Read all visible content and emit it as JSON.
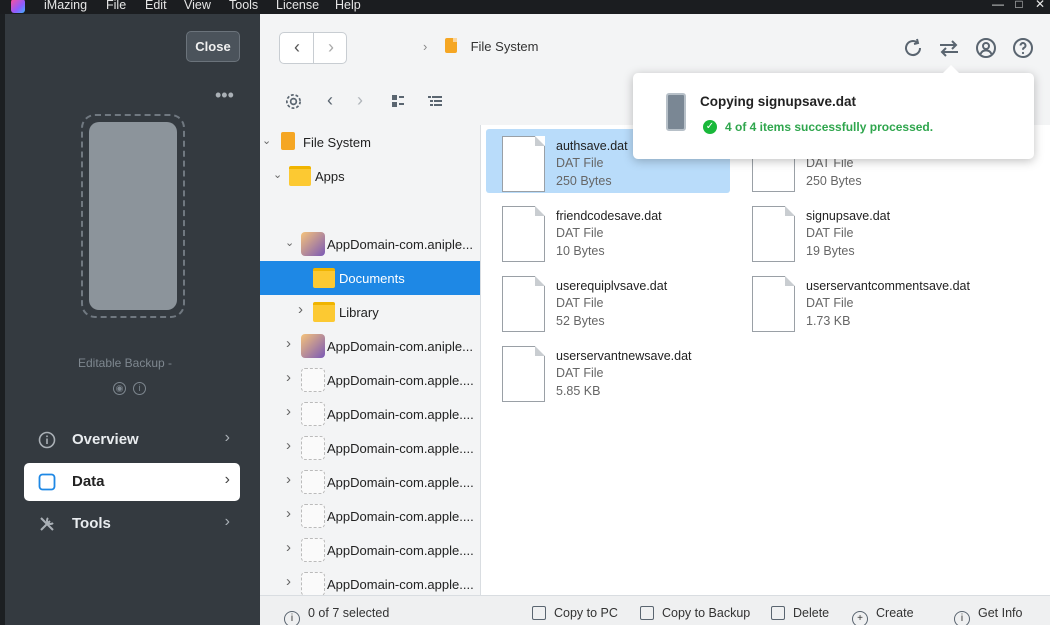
{
  "menubar": {
    "app_name": "iMazing",
    "items": [
      "File",
      "Edit",
      "View",
      "Tools",
      "License",
      "Help"
    ],
    "window_controls": [
      "—",
      "□",
      "✕"
    ]
  },
  "sidebar": {
    "close_label": "Close",
    "more_label": "•••",
    "backup_label": "Editable Backup -",
    "nav": [
      {
        "label": "Overview",
        "icon": "info-icon"
      },
      {
        "label": "Data",
        "icon": "checkbox-icon"
      },
      {
        "label": "Tools",
        "icon": "wrench-icon"
      }
    ]
  },
  "toolbar": {
    "back": "‹",
    "forward": "›",
    "breadcrumb_sep": "›",
    "breadcrumb": "File System",
    "icons": [
      "refresh-icon",
      "transfer-icon",
      "account-icon",
      "help-icon"
    ]
  },
  "tree": {
    "rows": [
      {
        "label": "File System",
        "arrow": "⌄",
        "icon": "filesystem"
      },
      {
        "label": "Apps",
        "arrow": "⌄",
        "icon": "folder"
      },
      {
        "label": "AppDomain-com.aniple...",
        "arrow": "⌄",
        "icon": "app"
      },
      {
        "label": "Documents",
        "arrow": "",
        "icon": "folder"
      },
      {
        "label": "Library",
        "arrow": "›",
        "icon": "folder"
      },
      {
        "label": "AppDomain-com.aniple...",
        "arrow": "›",
        "icon": "app"
      },
      {
        "label": "AppDomain-com.apple....",
        "arrow": "›",
        "icon": "apple"
      },
      {
        "label": "AppDomain-com.apple....",
        "arrow": "›",
        "icon": "apple"
      },
      {
        "label": "AppDomain-com.apple....",
        "arrow": "›",
        "icon": "apple"
      },
      {
        "label": "AppDomain-com.apple....",
        "arrow": "›",
        "icon": "apple"
      },
      {
        "label": "AppDomain-com.apple....",
        "arrow": "›",
        "icon": "apple"
      },
      {
        "label": "AppDomain-com.apple....",
        "arrow": "›",
        "icon": "apple"
      },
      {
        "label": "AppDomain-com.apple....",
        "arrow": "›",
        "icon": "apple"
      }
    ]
  },
  "files": [
    {
      "name": "authsave.dat",
      "type": "DAT File",
      "size": "250 Bytes",
      "selected": true
    },
    {
      "name": "",
      "type": "DAT File",
      "size": "250 Bytes",
      "selected": false
    },
    {
      "name": "friendcodesave.dat",
      "type": "DAT File",
      "size": "10 Bytes",
      "selected": false
    },
    {
      "name": "signupsave.dat",
      "type": "DAT File",
      "size": "19 Bytes",
      "selected": false
    },
    {
      "name": "userequiplvsave.dat",
      "type": "DAT File",
      "size": "52 Bytes",
      "selected": false
    },
    {
      "name": "userservantcommentsave.dat",
      "type": "DAT File",
      "size": "1.73 KB",
      "selected": false
    },
    {
      "name": "userservantnewsave.dat",
      "type": "DAT File",
      "size": "5.85 KB",
      "selected": false
    }
  ],
  "popup": {
    "title": "Copying signupsave.dat",
    "status": "4 of 4 items successfully processed."
  },
  "bottombar": {
    "selection": "0 of 7 selected",
    "actions": [
      "Copy to PC",
      "Copy to Backup",
      "Delete",
      "Create",
      "Get Info"
    ]
  },
  "colors": {
    "sidebar_bg": "#343a40",
    "selection_blue": "#1e88e5",
    "file_selected": "#b9dcfa",
    "success_green": "#19b83a"
  }
}
